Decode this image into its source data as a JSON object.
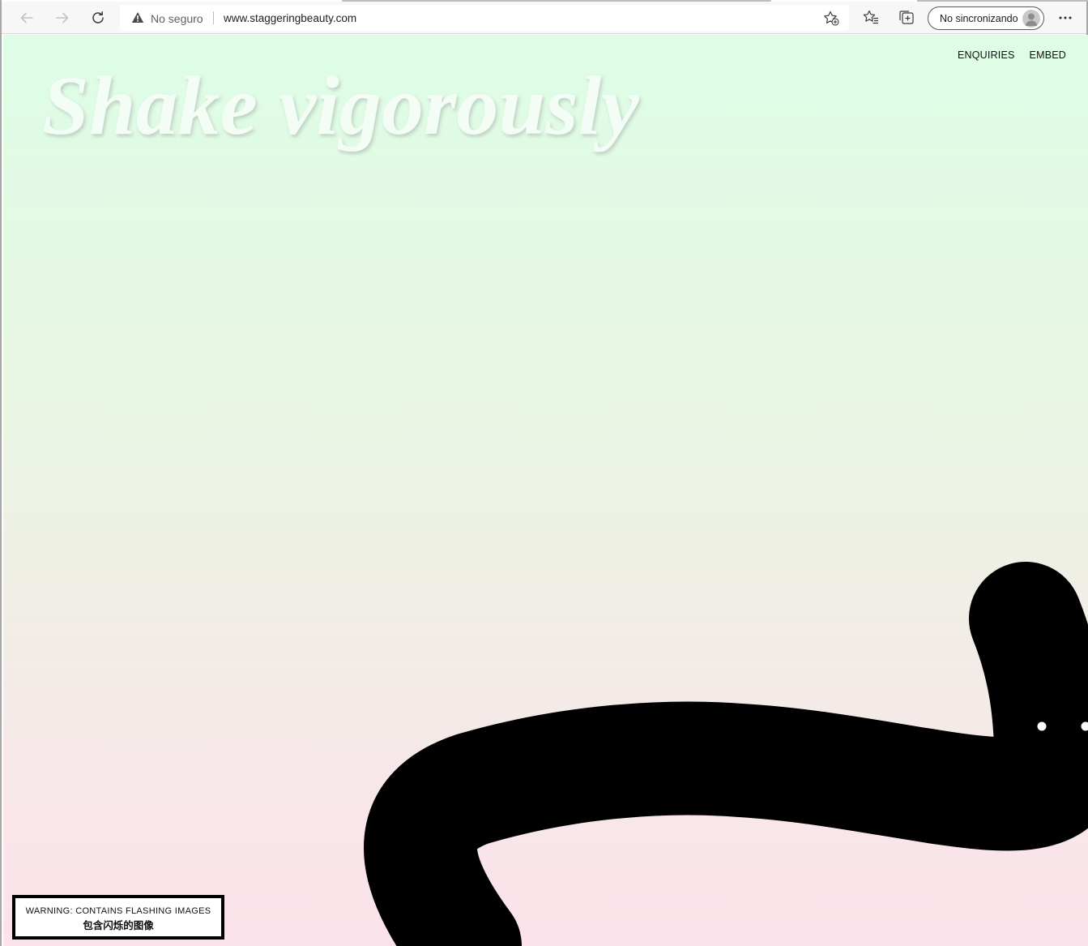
{
  "browser": {
    "security_label": "No seguro",
    "url": "www.staggeringbeauty.com",
    "profile_label": "No sincronizando",
    "icons": {
      "back": "back-arrow-icon",
      "forward": "forward-arrow-icon",
      "refresh": "refresh-icon",
      "warning": "warning-triangle-icon",
      "add_favorite": "star-add-icon",
      "favorites": "favorites-list-icon",
      "collections": "collections-icon",
      "profile": "user-avatar-icon",
      "more": "more-dots-icon"
    }
  },
  "page": {
    "headline": "Shake vigorously",
    "nav": {
      "enquiries": "ENQUIRIES",
      "embed": "EMBED"
    },
    "warning": {
      "line1": "WARNING: CONTAINS FLASHING IMAGES",
      "line2": "包含闪烁的图像"
    },
    "colors": {
      "gradient_top": "#ddfde6",
      "gradient_bottom": "#fce2ea",
      "creature": "#000000",
      "headline": "#f3fdf5"
    }
  }
}
